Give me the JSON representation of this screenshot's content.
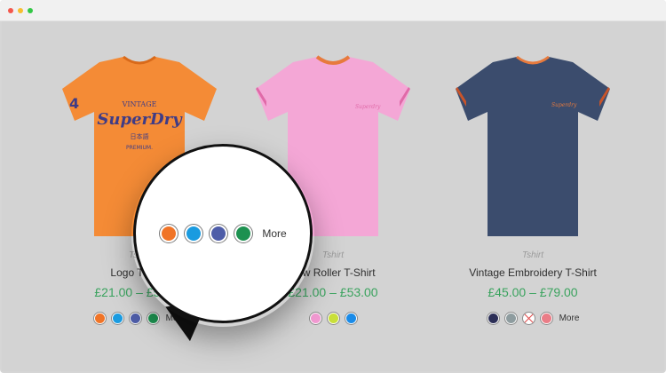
{
  "window": {
    "controls": [
      "close",
      "minimize",
      "maximize"
    ]
  },
  "products": [
    {
      "category": "Tshirt",
      "title": "Logo T-Shirt",
      "price": "£21.00 – £53.00",
      "shirt_color": "#f48b36",
      "swatches": [
        {
          "name": "orange",
          "color": "#f07427"
        },
        {
          "name": "blue",
          "color": "#1a9be0"
        },
        {
          "name": "indigo",
          "color": "#4e5da8"
        },
        {
          "name": "green",
          "color": "#1d9150"
        }
      ],
      "more_label": "More"
    },
    {
      "category": "Tshirt",
      "title": "Low Roller T-Shirt",
      "price": "£21.00 – £53.00",
      "shirt_color": "#f4a7d6",
      "swatches": [
        {
          "name": "pink",
          "color": "#f29ad2"
        },
        {
          "name": "lime",
          "color": "#c9df3a"
        },
        {
          "name": "blue",
          "color": "#1a8be8"
        }
      ]
    },
    {
      "category": "Tshirt",
      "title": "Vintage Embroidery T-Shirt",
      "price": "£45.00 – £79.00",
      "shirt_color": "#3b4c6d",
      "swatches": [
        {
          "name": "navy",
          "color": "#2c2f57"
        },
        {
          "name": "grey",
          "color": "#8e9c9f"
        },
        {
          "name": "unavailable",
          "color": "#ffffff"
        },
        {
          "name": "salmon",
          "color": "#ea7d87"
        }
      ],
      "more_label": "More"
    }
  ],
  "zoom": {
    "swatches": [
      {
        "name": "orange",
        "color": "#f07427"
      },
      {
        "name": "blue",
        "color": "#1a9be0"
      },
      {
        "name": "indigo",
        "color": "#4e5da8"
      },
      {
        "name": "green",
        "color": "#1d9150"
      }
    ],
    "more_label": "More"
  },
  "colors": {
    "price": "#3aa35e",
    "background": "#d3d3d3"
  }
}
